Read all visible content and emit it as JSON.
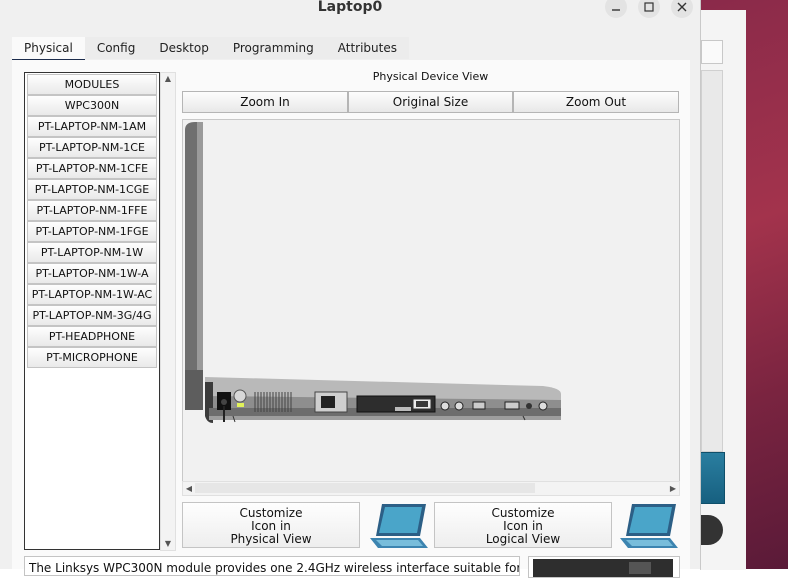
{
  "window": {
    "title": "Laptop0"
  },
  "tabs": [
    {
      "label": "Physical"
    },
    {
      "label": "Config"
    },
    {
      "label": "Desktop"
    },
    {
      "label": "Programming"
    },
    {
      "label": "Attributes"
    }
  ],
  "modules": {
    "items": [
      {
        "label": "MODULES"
      },
      {
        "label": "WPC300N"
      },
      {
        "label": "PT-LAPTOP-NM-1AM"
      },
      {
        "label": "PT-LAPTOP-NM-1CE"
      },
      {
        "label": "PT-LAPTOP-NM-1CFE"
      },
      {
        "label": "PT-LAPTOP-NM-1CGE"
      },
      {
        "label": "PT-LAPTOP-NM-1FFE"
      },
      {
        "label": "PT-LAPTOP-NM-1FGE"
      },
      {
        "label": "PT-LAPTOP-NM-1W"
      },
      {
        "label": "PT-LAPTOP-NM-1W-A"
      },
      {
        "label": "PT-LAPTOP-NM-1W-AC"
      },
      {
        "label": "PT-LAPTOP-NM-3G/4G"
      },
      {
        "label": "PT-HEADPHONE"
      },
      {
        "label": "PT-MICROPHONE"
      }
    ]
  },
  "physical_view": {
    "label": "Physical Device View",
    "zoom_in": "Zoom In",
    "original_size": "Original Size",
    "zoom_out": "Zoom Out"
  },
  "customize": {
    "physical": {
      "line1": "Customize",
      "line2": "Icon in",
      "line3": "Physical View"
    },
    "logical": {
      "line1": "Customize",
      "line2": "Icon in",
      "line3": "Logical View"
    }
  },
  "description": "The Linksys WPC300N module provides one 2.4GHz wireless interface suitable for",
  "icons": {
    "minimize": "minimize-icon",
    "maximize": "maximize-icon",
    "close": "close-icon",
    "laptop": "laptop-icon"
  },
  "colors": {
    "accent": "#1c2c4c"
  }
}
